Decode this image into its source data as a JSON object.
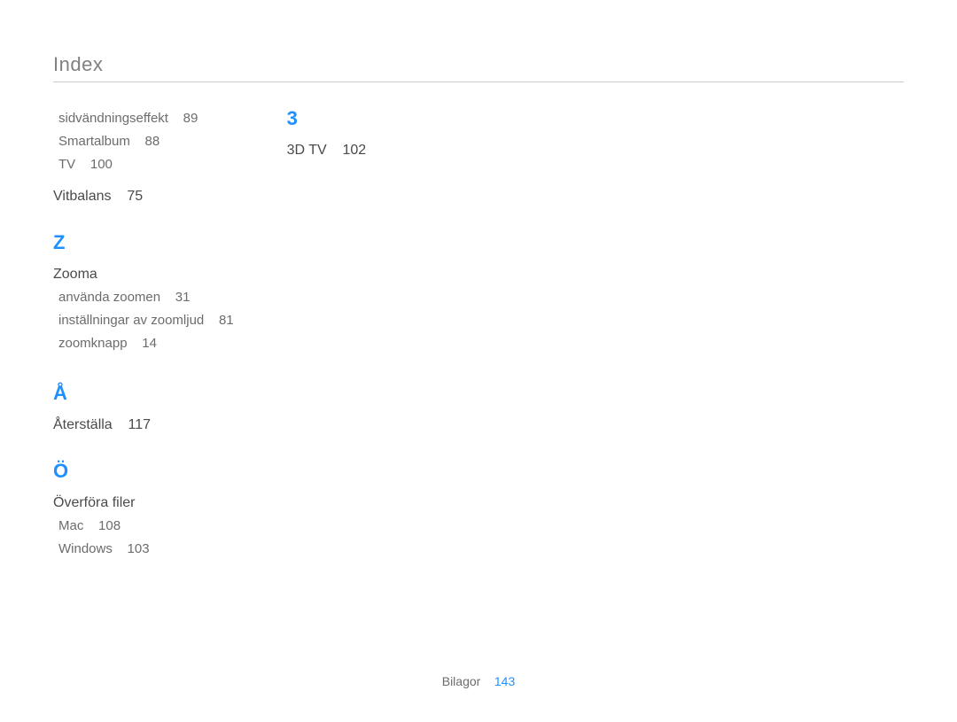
{
  "title": "Index",
  "column1": {
    "top_entries": [
      {
        "label": "sidvändningseffekt",
        "page": "89"
      },
      {
        "label": "Smartalbum",
        "page": "88"
      },
      {
        "label": "TV",
        "page": "100"
      }
    ],
    "vitbalans": {
      "label": "Vitbalans",
      "page": "75"
    },
    "letter_z": "Z",
    "zooma_heading": "Zooma",
    "zooma_sub": [
      {
        "label": "använda zoomen",
        "page": "31"
      },
      {
        "label": "inställningar av zoomljud",
        "page": "81"
      },
      {
        "label": "zoomknapp",
        "page": "14"
      }
    ],
    "letter_a_ring": "Å",
    "aterstalla": {
      "label": "Återställa",
      "page": "117"
    },
    "letter_o_uml": "Ö",
    "overfora_heading": "Överföra filer",
    "overfora_sub": [
      {
        "label": "Mac",
        "page": "108"
      },
      {
        "label": "Windows",
        "page": "103"
      }
    ]
  },
  "column2": {
    "letter_3": "3",
    "threed_tv": {
      "label": "3D TV",
      "page": "102"
    }
  },
  "footer": {
    "label": "Bilagor",
    "page": "143"
  }
}
